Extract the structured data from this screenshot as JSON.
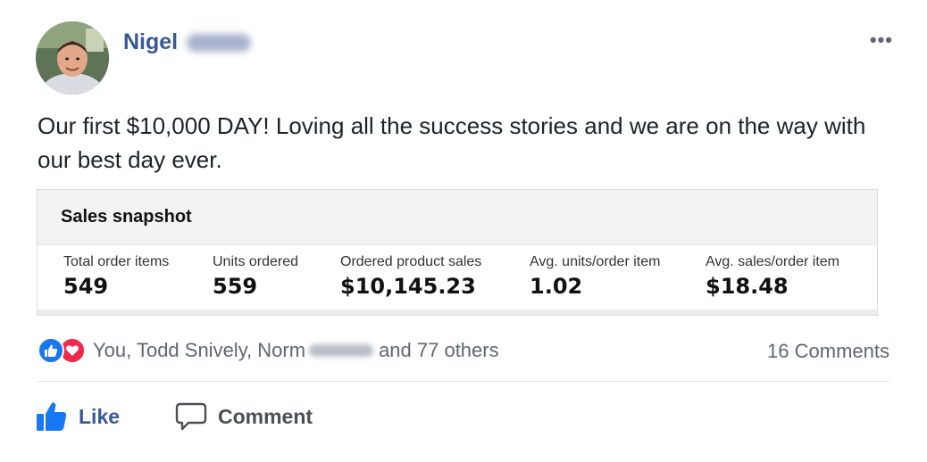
{
  "post": {
    "author_name": "Nigel",
    "more_label": "•••",
    "text": "Our first $10,000 DAY! Loving all the success stories and we are on the way with our best day ever."
  },
  "snapshot": {
    "title": "Sales snapshot",
    "metrics": [
      {
        "label": "Total order items",
        "value": "549"
      },
      {
        "label": "Units ordered",
        "value": "559"
      },
      {
        "label": "Ordered product sales",
        "value": "$10,145.23"
      },
      {
        "label": "Avg. units/order item",
        "value": "1.02"
      },
      {
        "label": "Avg. sales/order item",
        "value": "$18.48"
      }
    ]
  },
  "reactions": {
    "icons": [
      "like-icon",
      "love-icon"
    ],
    "names_prefix": "You, Todd Snively, Norm",
    "names_suffix": "and 77 others",
    "comments": "16 Comments"
  },
  "actions": {
    "like_label": "Like",
    "comment_label": "Comment"
  },
  "colors": {
    "name_blue": "#385898",
    "like_blue": "#1877f2",
    "love_red": "#f0284a",
    "muted_gray": "#606770"
  }
}
